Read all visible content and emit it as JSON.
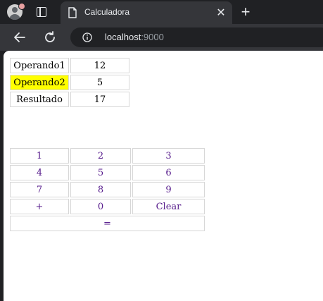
{
  "browser": {
    "tab_title": "Calculadora",
    "url_host": "localhost",
    "url_port": ":9000"
  },
  "operands": {
    "rows": [
      {
        "label": "Operando1",
        "value": "12"
      },
      {
        "label": "Operando2",
        "value": "5"
      },
      {
        "label": "Resultado",
        "value": "17"
      }
    ],
    "highlight_color": "#ffff00"
  },
  "keypad": {
    "rows": [
      [
        "1",
        "2",
        "3"
      ],
      [
        "4",
        "5",
        "6"
      ],
      [
        "7",
        "8",
        "9"
      ],
      [
        "+",
        "0",
        "Clear"
      ]
    ],
    "equals": "="
  },
  "colors": {
    "link": "#551a8b",
    "chrome_dark": "#202124",
    "chrome_toolbar": "#35363a"
  }
}
